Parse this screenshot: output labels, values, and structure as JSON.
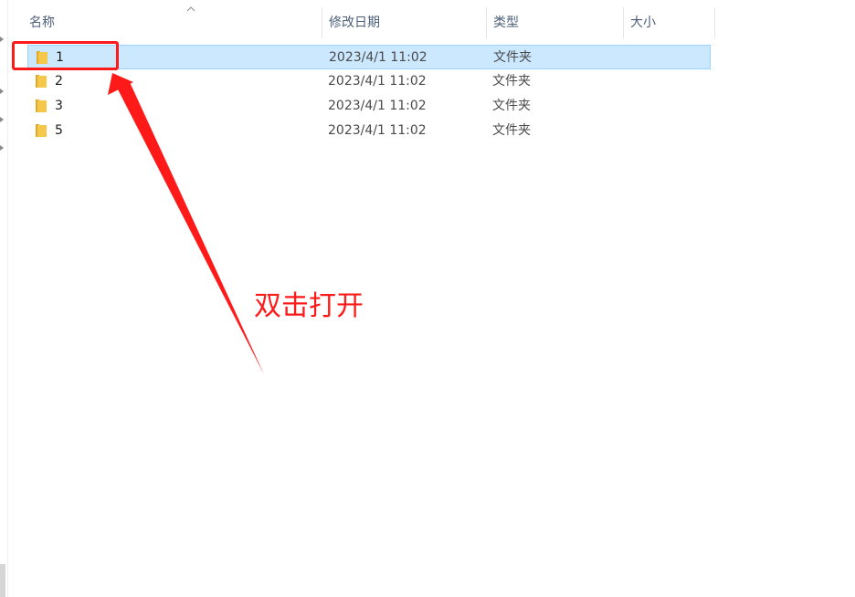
{
  "columns": {
    "name": "名称",
    "modified": "修改日期",
    "type": "类型",
    "size": "大小"
  },
  "files": [
    {
      "name": "1",
      "modified": "2023/4/1 11:02",
      "type": "文件夹",
      "selected": true
    },
    {
      "name": "2",
      "modified": "2023/4/1 11:02",
      "type": "文件夹",
      "selected": false
    },
    {
      "name": "3",
      "modified": "2023/4/1 11:02",
      "type": "文件夹",
      "selected": false
    },
    {
      "name": "5",
      "modified": "2023/4/1 11:02",
      "type": "文件夹",
      "selected": false
    }
  ],
  "annotation": {
    "text": "双击打开",
    "color": "#ff1a1a"
  },
  "colors": {
    "selection_bg": "#cce8ff",
    "selection_border": "#99d1ff",
    "header_text": "#4c607a",
    "folder": "#f5c84c"
  },
  "icons": {
    "folder": "folder-icon",
    "sort": "sort-ascending-icon"
  }
}
